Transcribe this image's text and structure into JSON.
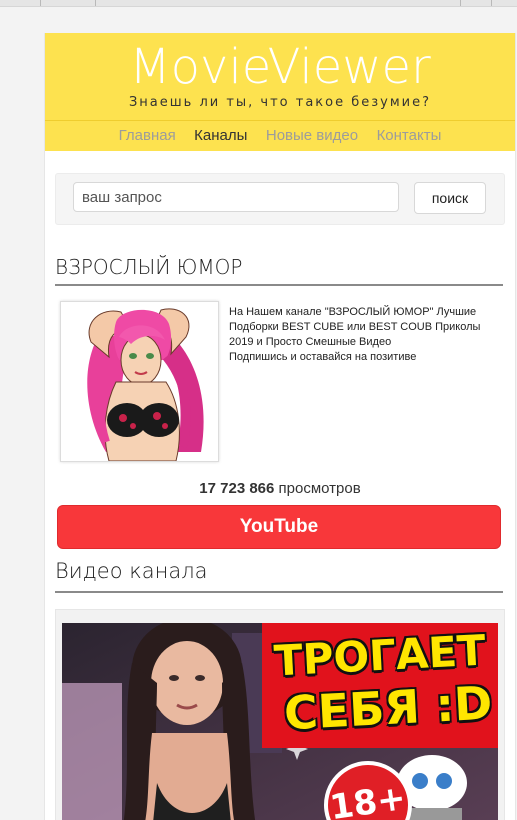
{
  "site": {
    "logo": "MovieViewer",
    "tagline": "Знаешь ли ты, что такое безумие?"
  },
  "nav": {
    "items": [
      {
        "label": "Главная",
        "active": false
      },
      {
        "label": "Каналы",
        "active": true
      },
      {
        "label": "Новые видео",
        "active": false
      },
      {
        "label": "Контакты",
        "active": false
      }
    ]
  },
  "search": {
    "placeholder": "ваш запрос",
    "button_label": "поиск"
  },
  "channel": {
    "title": "ВЗРОСЛЫЙ ЮМОР",
    "description_line1": "На Нашем канале \"ВЗРОСЛЫЙ ЮМОР\" Лучшие Подборки BEST CUBE или BEST COUB Приколы 2019 и Просто Смешные Видео",
    "description_line2": "Подпишись и оставайся на позитиве",
    "views_count": "17 723 866",
    "views_label": "просмотров",
    "youtube_button": "YouTube"
  },
  "videos": {
    "section_title": "Видео канала",
    "items": [
      {
        "overlay_line1": "ТРОГАЕТ",
        "overlay_line2": "СЕБЯ :D",
        "badge": "18+"
      }
    ]
  },
  "colors": {
    "header_bg": "#fde24f",
    "youtube_red": "#f8373a",
    "nav_inactive": "#9c9c9c",
    "nav_active": "#333333"
  }
}
